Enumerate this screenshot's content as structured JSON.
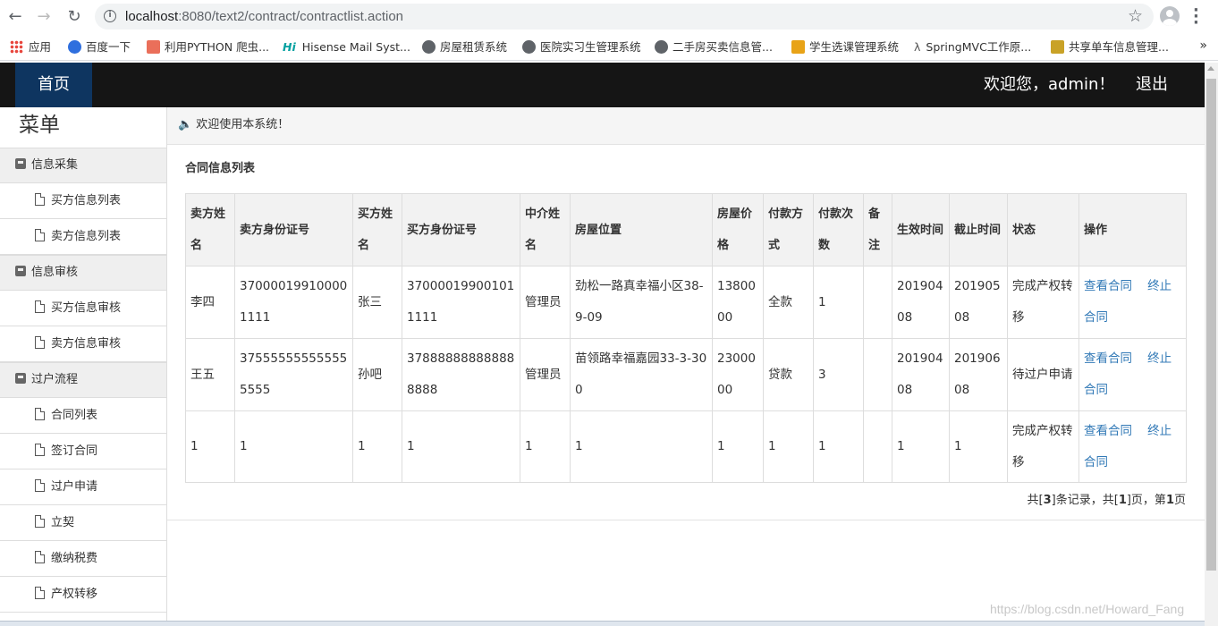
{
  "browser": {
    "url_host": "localhost",
    "url_rest": ":8080/text2/contract/contractlist.action",
    "bookmarks": [
      {
        "label": "应用",
        "icon": "apps-grid-icon",
        "color": "#e8453c"
      },
      {
        "label": "百度一下",
        "icon": "baidu-paw-icon",
        "color": "#2f6fde"
      },
      {
        "label": "利用PYTHON 爬虫...",
        "icon": "jianshu-icon",
        "color": "#ea6f5a"
      },
      {
        "label": "Hisense Mail Syst...",
        "icon": "hisense-icon",
        "color": "#00a0a0"
      },
      {
        "label": "房屋租赁系统",
        "icon": "globe-icon",
        "color": "#5f6368"
      },
      {
        "label": "医院实习生管理系统",
        "icon": "globe-icon",
        "color": "#5f6368"
      },
      {
        "label": "二手房买卖信息管...",
        "icon": "globe-icon",
        "color": "#5f6368"
      },
      {
        "label": "学生选课管理系统",
        "icon": "course-icon",
        "color": "#e8a317"
      },
      {
        "label": "SpringMVC工作原...",
        "icon": "spring-icon",
        "color": "#555555"
      },
      {
        "label": "共享单车信息管理...",
        "icon": "chart-icon",
        "color": "#c9a227"
      }
    ],
    "more_bookmarks": "»"
  },
  "header": {
    "home_label": "首页",
    "welcome": "欢迎您，admin！",
    "logout_label": "退出",
    "bg_color": "#151515",
    "home_color": "#0e3560"
  },
  "sidebar": {
    "title": "菜单",
    "groups": [
      {
        "label": "信息采集",
        "items": [
          "买方信息列表",
          "卖方信息列表"
        ]
      },
      {
        "label": "信息审核",
        "items": [
          "买方信息审核",
          "卖方信息审核"
        ]
      },
      {
        "label": "过户流程",
        "items": [
          "合同列表",
          "签订合同",
          "过户申请",
          "立契",
          "缴纳税费",
          "产权转移"
        ]
      }
    ]
  },
  "notice": "欢迎使用本系统！",
  "panel": {
    "title": "合同信息列表",
    "columns": [
      "卖方姓名",
      "卖方身份证号",
      "买方姓名",
      "买方身份证号",
      "中介姓名",
      "房屋位置",
      "房屋价格",
      "付款方式",
      "付款次数",
      "备注",
      "生效时间",
      "截止时间",
      "状态",
      "操作"
    ],
    "rows": [
      {
        "seller": "李四",
        "seller_id": "370000199100001111",
        "buyer": "张三",
        "buyer_id": "370000199001011111",
        "agent": "管理员",
        "location": "劲松一路真幸福小区38-9-09",
        "price": "1380000",
        "pay_method": "全款",
        "pay_times": "1",
        "remark": "",
        "start": "20190408",
        "end": "20190508",
        "status": "完成产权转移",
        "view": "查看合同",
        "terminate": "终止合同"
      },
      {
        "seller": "王五",
        "seller_id": "375555555555555555",
        "buyer": "孙吧",
        "buyer_id": "378888888888888888",
        "agent": "管理员",
        "location": "苗领路幸福嘉园33-3-300",
        "price": "2300000",
        "pay_method": "贷款",
        "pay_times": "3",
        "remark": "",
        "start": "20190408",
        "end": "20190608",
        "status": "待过户申请",
        "view": "查看合同",
        "terminate": "终止合同"
      },
      {
        "seller": "1",
        "seller_id": "1",
        "buyer": "1",
        "buyer_id": "1",
        "agent": "1",
        "location": "1",
        "price": "1",
        "pay_method": "1",
        "pay_times": "1",
        "remark": "",
        "start": "1",
        "end": "1",
        "status": "完成产权转移",
        "view": "查看合同",
        "terminate": "终止合同"
      }
    ],
    "pager": {
      "prefix": "共[",
      "total": "3",
      "mid1": "]条记录，共[",
      "pages": "1",
      "mid2": "]页，第",
      "current": "1",
      "suffix": "页"
    },
    "link_color": "#337ab7"
  },
  "watermark": "https://blog.csdn.net/Howard_Fang"
}
